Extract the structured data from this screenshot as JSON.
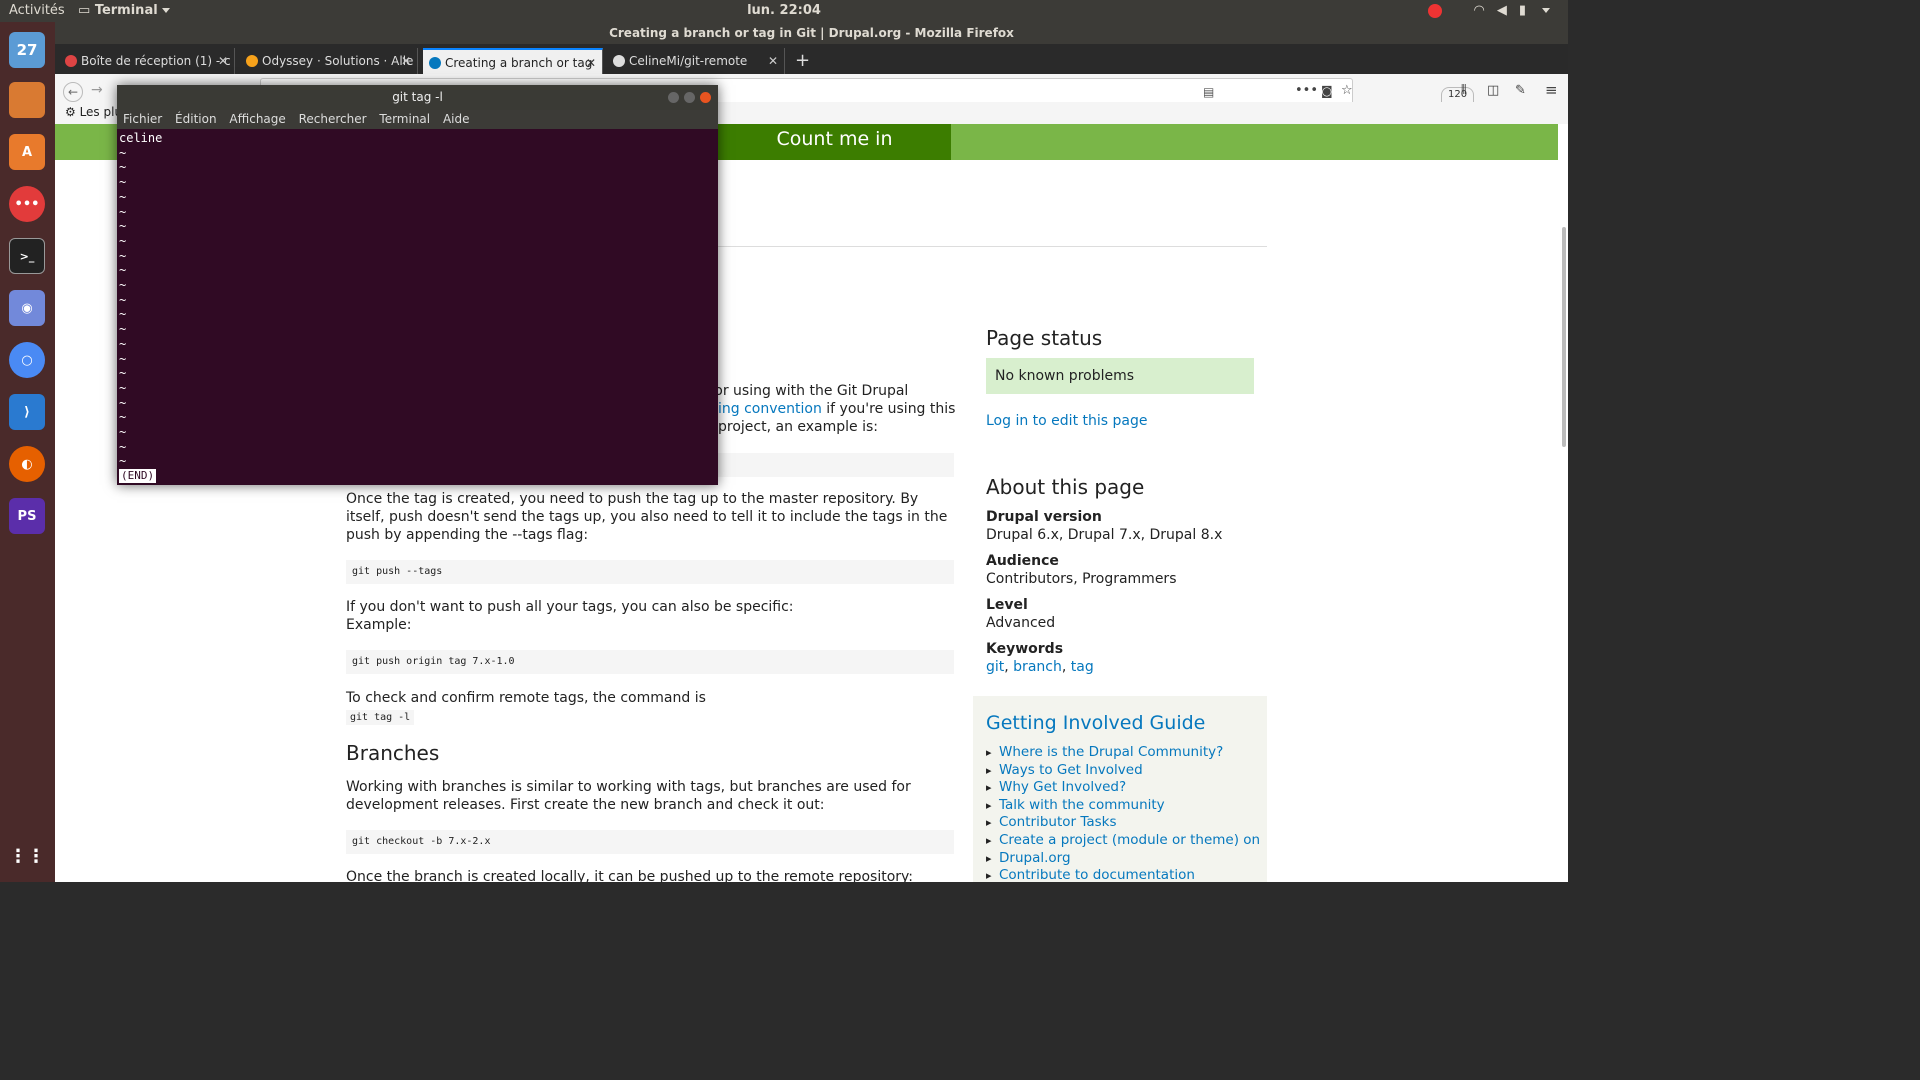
{
  "topbar": {
    "activities": "Activités",
    "app": "Terminal",
    "clock": "lun. 22:04"
  },
  "dock": {
    "calendar_day": "27",
    "items": [
      "calendar-icon",
      "files-icon",
      "software-icon",
      "chat-icon",
      "terminal-icon",
      "discord-icon",
      "chromium-icon",
      "vscode-icon",
      "firefox-icon",
      "phpstorm-icon",
      "apps-grid-icon"
    ]
  },
  "firefox": {
    "window_title": "Creating a branch or tag in Git | Drupal.org - Mozilla Firefox",
    "tabs": [
      {
        "label": "Boîte de réception (1) - c",
        "active": false
      },
      {
        "label": "Odyssey · Solutions · Alle",
        "active": false
      },
      {
        "label": "Creating a branch or tag",
        "active": true
      },
      {
        "label": "CelineMi/git-remote",
        "active": false
      }
    ],
    "tab_close": "✕",
    "new_tab": "+",
    "zoom": "120 %",
    "bookmarks_label": "Les plu",
    "page": {
      "count_me_in": "Count me in",
      "lines": [
        {
          "text": "g for using with the Git Drupal"
        },
        {
          "text": "ing convention",
          "link": true,
          "suffix": " if you're using this"
        },
        {
          "text": "project, an example is:"
        }
      ],
      "para1": "Once the tag is created, you need to push the tag up to the master repository. By itself, push doesn't send the tags up, you also need to tell it to include the tags in the push by appending the --tags flag:",
      "code1": "git push --tags",
      "para2a": "If you don't want to push all your tags, you can also be specific:",
      "para2b": "Example:",
      "code2": "git push origin tag 7.x-1.0",
      "para3": "To check and confirm remote tags, the command is",
      "code3": "git tag -l",
      "branches_heading": "Branches",
      "para4": "Working with branches is similar to working with tags, but branches are used for development releases. First create the new branch and check it out:",
      "code4": "git checkout -b 7.x-2.x",
      "para5": "Once the branch is created locally, it can be pushed up to the remote repository:"
    },
    "sidebar": {
      "page_status_title": "Page status",
      "status": "No known problems",
      "login_link": "Log in to edit this page",
      "about_title": "About this page",
      "drupal_version_label": "Drupal version",
      "drupal_version": "Drupal 6.x, Drupal 7.x, Drupal 8.x",
      "audience_label": "Audience",
      "audience": "Contributors, Programmers",
      "level_label": "Level",
      "level": "Advanced",
      "keywords_label": "Keywords",
      "kw1": "git",
      "kw2": "branch",
      "kw3": "tag",
      "guide_title": "Getting Involved Guide",
      "guide_items": [
        "Where is the Drupal Community?",
        "Ways to Get Involved",
        "Why Get Involved?",
        "Talk with the community",
        "Contributor Tasks",
        "Create a project (module or theme) on",
        "Drupal.org",
        "Contribute to documentation"
      ]
    }
  },
  "terminal": {
    "title": "git tag -l",
    "menu": [
      "Fichier",
      "Édition",
      "Affichage",
      "Rechercher",
      "Terminal",
      "Aide"
    ],
    "output_first": "celine",
    "tilde": "~",
    "end": "(END)"
  }
}
